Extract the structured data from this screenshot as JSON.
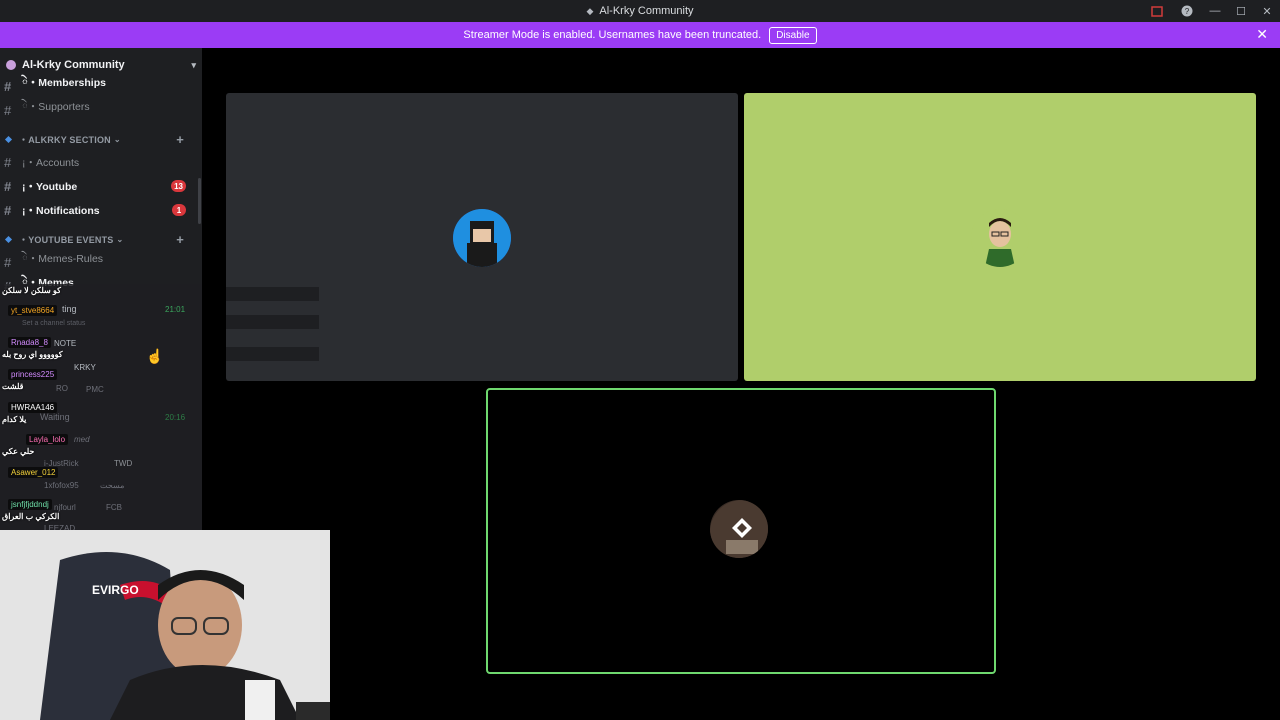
{
  "window": {
    "title": "Al-Krky Community",
    "controls": [
      "minimize-icon",
      "maximize-icon",
      "close-icon"
    ]
  },
  "streamer_banner": {
    "text": "Streamer Mode is enabled. Usernames have been truncated.",
    "button": "Disable",
    "bg_color": "#9b3cf5"
  },
  "sidebar": {
    "server_name": "Al-Krky Community",
    "channels_top": [
      {
        "label": "ེ・Memberships",
        "bold": true
      },
      {
        "label": "ེ・Supporters",
        "bold": false
      }
    ],
    "category1": "・ALKRKY SECTION",
    "channels_cat1": [
      {
        "label": "¡・Accounts",
        "bold": false,
        "badge": ""
      },
      {
        "label": "¡・Youtube",
        "bold": true,
        "badge": "13"
      },
      {
        "label": "¡・Notifications",
        "bold": true,
        "badge": "1"
      }
    ],
    "category2": "・YOUTUBE EVENTS",
    "channels_cat2": [
      {
        "label": "ེ・Memes-Rules",
        "bold": false
      },
      {
        "label": "ེ・Memes",
        "bold": true
      }
    ]
  },
  "chat_overlay": {
    "messages": [
      {
        "name": "",
        "text": "كو سلكن لا سلكن",
        "color": "#ffffff"
      },
      {
        "name": "yt_stve8664",
        "text": "",
        "color": "#f5a623"
      },
      {
        "name": "Rnada8_8",
        "text": "كووووو اي روح بله",
        "color": "#d38cff"
      },
      {
        "name": "princess225",
        "text": "قلشت",
        "color": "#d38cff"
      },
      {
        "name": "HWRAA146",
        "text": "يلا كدام",
        "color": "#ffffff"
      },
      {
        "name": "Layla_lolo",
        "text": "حلي عكي",
        "color": "#ff6fb5"
      },
      {
        "name": "Asawer_012",
        "text": "",
        "color": "#f5d33a"
      },
      {
        "name": "jsnfjfjddndj",
        "text": "الكركي ب العراق",
        "color": "#6fe0a8"
      }
    ],
    "ghost_texts": [
      "ting",
      "21:01",
      "Set a channel status",
      "NOTE",
      "KRKY",
      "RO",
      "PMC",
      "Waiting",
      "20:16",
      "med",
      "i-JustRick",
      "TWD",
      "1xfofox95",
      "مسحت",
      "njfourl",
      "FCB",
      "LEEZAD"
    ]
  },
  "call": {
    "tiles": [
      {
        "bg": "#2b2d31",
        "avatar": "user-avatar-1"
      },
      {
        "bg": "#b0ce6b",
        "avatar": "user-avatar-2"
      },
      {
        "bg": "#000000",
        "avatar": "user-avatar-3",
        "speaking": true
      }
    ]
  },
  "webcam": {
    "chair_text": "EVIRGO"
  }
}
